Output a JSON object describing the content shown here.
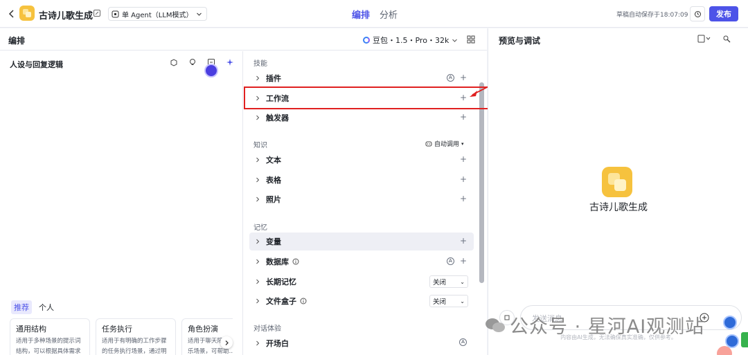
{
  "header": {
    "app_title": "古诗儿歌生成",
    "agent_mode": "单 Agent（LLM模式）",
    "tabs": [
      {
        "label": "编排",
        "active": true
      },
      {
        "label": "分析",
        "active": false
      }
    ],
    "autosave": "草稿自动保存于18:07:09",
    "publish_label": "发布",
    "accent_color": "#4d53e8"
  },
  "editor": {
    "title": "编排",
    "model": "豆包・1.5・Pro・32k"
  },
  "persona": {
    "title": "人设与回复逻辑",
    "template_tabs": [
      "推荐",
      "个人"
    ],
    "templates": [
      {
        "title": "通用结构",
        "desc": "适用于多种场景的提示词结构，可以根据具体需求增删对应模块"
      },
      {
        "title": "任务执行",
        "desc": "适用于有明确的工作步骤的任务执行场景，通过明确每一步骤的工作要求…"
      },
      {
        "title": "角色扮演",
        "desc": "适用于聊天陪伴、互动娱乐场景，可帮助…塑造个性化的人物…"
      }
    ]
  },
  "skills": {
    "skills_label": "技能",
    "plugin": "插件",
    "workflow": "工作流",
    "trigger": "触发器",
    "knowledge_label": "知识",
    "auto_call": "自动调用",
    "text": "文本",
    "table": "表格",
    "photo": "照片",
    "memory_label": "记忆",
    "variable": "变量",
    "database": "数据库",
    "long_memory": "长期记忆",
    "long_memory_value": "关闭",
    "file_box": "文件盒子",
    "file_box_value": "关闭",
    "dialog_label": "对话体验",
    "opening": "开场白",
    "highlight_color": "#e02020"
  },
  "preview": {
    "title": "预览与调试",
    "bot_name": "古诗儿歌生成",
    "input_placeholder": "发送消息",
    "disclaimer": "内容由AI生成，无法确保真实准确，仅供参考。"
  },
  "watermark": {
    "text": "公众号 · 星河AI观测站"
  }
}
